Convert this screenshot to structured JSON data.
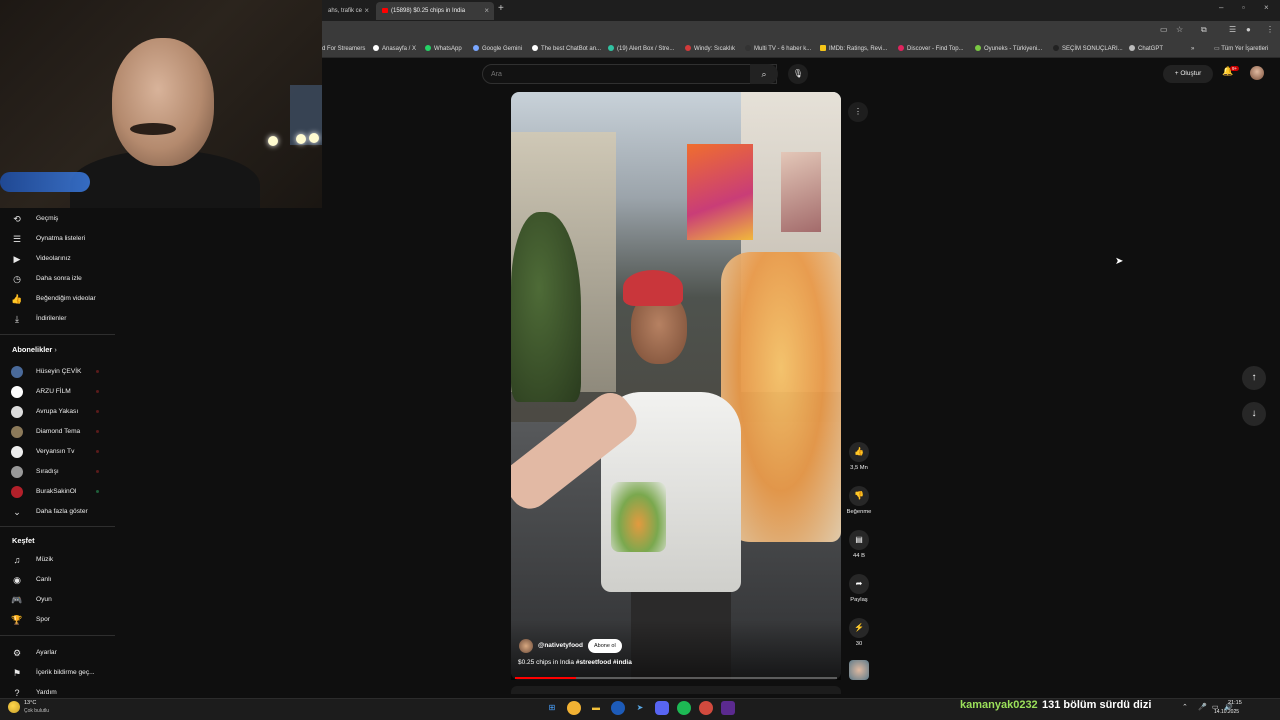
{
  "browser": {
    "tabs": [
      {
        "label": "ahs, trafik ce",
        "active": false
      },
      {
        "label": "(15898) $0.25 chips in India",
        "active": true
      }
    ],
    "bookmarks": [
      {
        "label": "d For Streamers",
        "color": "#777777"
      },
      {
        "label": "Anasayfa / X",
        "color": "#ffffff"
      },
      {
        "label": "WhatsApp",
        "color": "#25d366"
      },
      {
        "label": "Google Gemini",
        "color": "#7aa7ff"
      },
      {
        "label": "The best ChatBot an...",
        "color": "#ffffff"
      },
      {
        "label": "(19) Alert Box / Stre...",
        "color": "#31c3a2"
      },
      {
        "label": "Windy: Sıcaklık",
        "color": "#d23a3a"
      },
      {
        "label": "Multi TV - 6 haber k...",
        "color": "#333333"
      },
      {
        "label": "IMDb: Ratings, Revi...",
        "color": "#f5c518"
      },
      {
        "label": "Discover - Find Top...",
        "color": "#e0245e"
      },
      {
        "label": "Oyuneks - Türkiyeni...",
        "color": "#7ac943"
      },
      {
        "label": "SEÇİM SONUÇLARI...",
        "color": "#222222"
      },
      {
        "label": "ChatGPT",
        "color": "#bbbbbb"
      }
    ],
    "all_bookmarks_label": "Tüm Yer İşaretleri"
  },
  "youtube": {
    "search_placeholder": "Ara",
    "create_label": "Oluştur",
    "notif_badge": "9+",
    "sidebar": {
      "you_items": [
        {
          "icon": "history-icon",
          "glyph": "⟲",
          "label": "Geçmiş"
        },
        {
          "icon": "playlists-icon",
          "glyph": "☰",
          "label": "Oynatma listeleri"
        },
        {
          "icon": "your-videos-icon",
          "glyph": "▶",
          "label": "Videolarınız"
        },
        {
          "icon": "watch-later-icon",
          "glyph": "◷",
          "label": "Daha sonra izle"
        },
        {
          "icon": "liked-videos-icon",
          "glyph": "👍",
          "label": "Beğendiğim videolar"
        },
        {
          "icon": "downloads-icon",
          "glyph": "⤓",
          "label": "İndirilenler"
        }
      ],
      "subscriptions_title": "Abonelikler",
      "subscriptions": [
        {
          "label": "Hüseyin ÇEVİK",
          "color": "#4a6a9a",
          "live": true
        },
        {
          "label": "ARZU FİLM",
          "color": "#ffffff",
          "live": true
        },
        {
          "label": "Avrupa Yakası",
          "color": "#dddddd",
          "live": true
        },
        {
          "label": "Diamond Tema",
          "color": "#8c7a5a",
          "live": true
        },
        {
          "label": "Veryansın Tv",
          "color": "#eeeeee",
          "live": true
        },
        {
          "label": "Sıradışı",
          "color": "#999999",
          "live": true
        },
        {
          "label": "BurakSakinOl",
          "color": "#b3202a",
          "live": false
        }
      ],
      "show_more_label": "Daha fazla göster",
      "explore_title": "Keşfet",
      "explore_items": [
        {
          "icon": "music-icon",
          "glyph": "♫",
          "label": "Müzik"
        },
        {
          "icon": "live-icon",
          "glyph": "◉",
          "label": "Canlı"
        },
        {
          "icon": "gaming-icon",
          "glyph": "🎮",
          "label": "Oyun"
        },
        {
          "icon": "sports-icon",
          "glyph": "🏆",
          "label": "Spor"
        }
      ],
      "settings_items": [
        {
          "icon": "settings-icon",
          "glyph": "⚙",
          "label": "Ayarlar"
        },
        {
          "icon": "report-history-icon",
          "glyph": "⚑",
          "label": "İçerik bildirme geç..."
        },
        {
          "icon": "help-icon",
          "glyph": "?",
          "label": "Yardım"
        }
      ]
    },
    "short": {
      "channel": "@nativetyfood",
      "subscribe_label": "Abone ol",
      "title_prefix": "$0.25 chips in India ",
      "title_hashtags": "#streetfood #india",
      "progress": 0.19,
      "actions": {
        "like_count": "3,5 Mn",
        "dislike_label": "Beğenme",
        "comment_count": "44 B",
        "share_label": "Paylaş",
        "remix_count": "30"
      }
    }
  },
  "overlay": {
    "chat_user": "kamanyak0232",
    "chat_message": "131 bölüm sürdü dizi"
  },
  "taskbar": {
    "weather_temp": "13°C",
    "weather_desc": "Çok bulutlu",
    "time": "21:15",
    "date": "14.10.2025"
  }
}
